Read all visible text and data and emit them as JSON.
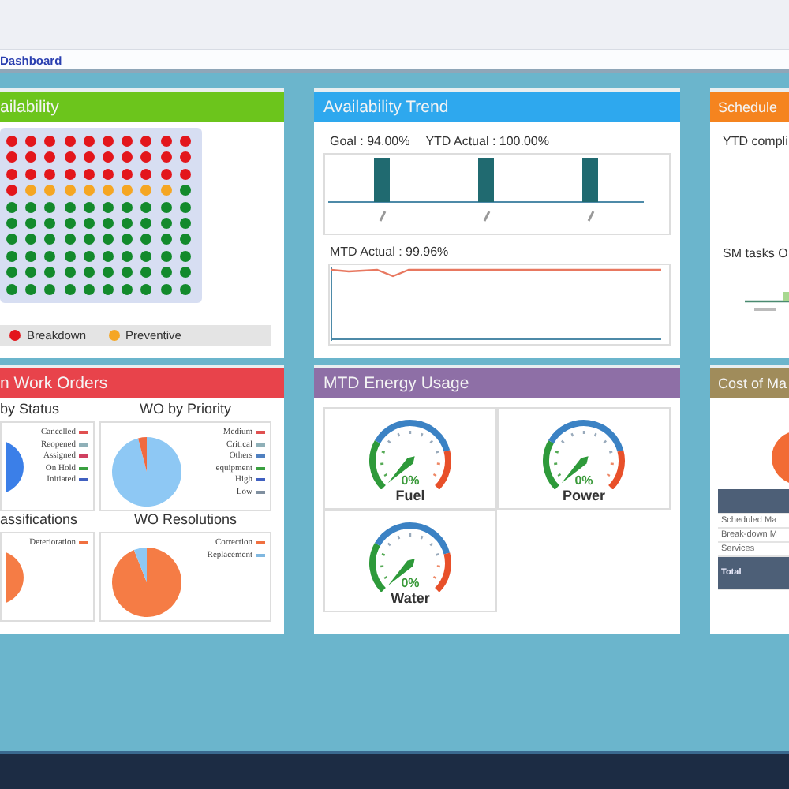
{
  "top_bar": {
    "breadcrumb": "Dashboard"
  },
  "availability": {
    "title": "ailability",
    "color": "#6cc51c",
    "dot_rows": [
      {
        "dots": [
          {
            "color": "#e3161c"
          },
          {
            "color": "#e3161c"
          },
          {
            "color": "#e3161c"
          },
          {
            "color": "#e3161c"
          },
          {
            "color": "#e3161c"
          },
          {
            "color": "#e3161c"
          },
          {
            "color": "#e3161c"
          },
          {
            "color": "#e3161c"
          },
          {
            "color": "#e3161c"
          },
          {
            "color": "#e3161c"
          }
        ]
      },
      {
        "dots": [
          {
            "color": "#e3161c"
          },
          {
            "color": "#e3161c"
          },
          {
            "color": "#e3161c"
          },
          {
            "color": "#e3161c"
          },
          {
            "color": "#e3161c"
          },
          {
            "color": "#e3161c"
          },
          {
            "color": "#e3161c"
          },
          {
            "color": "#e3161c"
          },
          {
            "color": "#e3161c"
          },
          {
            "color": "#e3161c"
          }
        ]
      },
      {
        "dots": [
          {
            "color": "#e3161c"
          },
          {
            "color": "#e3161c"
          },
          {
            "color": "#e3161c"
          },
          {
            "color": "#e3161c"
          },
          {
            "color": "#e3161c"
          },
          {
            "color": "#e3161c"
          },
          {
            "color": "#e3161c"
          },
          {
            "color": "#e3161c"
          },
          {
            "color": "#e3161c"
          },
          {
            "color": "#e3161c"
          }
        ]
      },
      {
        "dots": [
          {
            "color": "#e3161c"
          },
          {
            "color": "#f5a623"
          },
          {
            "color": "#f5a623"
          },
          {
            "color": "#f5a623"
          },
          {
            "color": "#f5a623"
          },
          {
            "color": "#f5a623"
          },
          {
            "color": "#f5a623"
          },
          {
            "color": "#f5a623"
          },
          {
            "color": "#f5a623"
          },
          {
            "color": "#138a2c"
          }
        ]
      },
      {
        "dots": [
          {
            "color": "#138a2c"
          },
          {
            "color": "#138a2c"
          },
          {
            "color": "#138a2c"
          },
          {
            "color": "#138a2c"
          },
          {
            "color": "#138a2c"
          },
          {
            "color": "#138a2c"
          },
          {
            "color": "#138a2c"
          },
          {
            "color": "#138a2c"
          },
          {
            "color": "#138a2c"
          },
          {
            "color": "#138a2c"
          }
        ]
      },
      {
        "dots": [
          {
            "color": "#138a2c"
          },
          {
            "color": "#138a2c"
          },
          {
            "color": "#138a2c"
          },
          {
            "color": "#138a2c"
          },
          {
            "color": "#138a2c"
          },
          {
            "color": "#138a2c"
          },
          {
            "color": "#138a2c"
          },
          {
            "color": "#138a2c"
          },
          {
            "color": "#138a2c"
          },
          {
            "color": "#138a2c"
          }
        ]
      },
      {
        "dots": [
          {
            "color": "#138a2c"
          },
          {
            "color": "#138a2c"
          },
          {
            "color": "#138a2c"
          },
          {
            "color": "#138a2c"
          },
          {
            "color": "#138a2c"
          },
          {
            "color": "#138a2c"
          },
          {
            "color": "#138a2c"
          },
          {
            "color": "#138a2c"
          },
          {
            "color": "#138a2c"
          },
          {
            "color": "#138a2c"
          }
        ]
      },
      {
        "dots": [
          {
            "color": "#138a2c"
          },
          {
            "color": "#138a2c"
          },
          {
            "color": "#138a2c"
          },
          {
            "color": "#138a2c"
          },
          {
            "color": "#138a2c"
          },
          {
            "color": "#138a2c"
          },
          {
            "color": "#138a2c"
          },
          {
            "color": "#138a2c"
          },
          {
            "color": "#138a2c"
          },
          {
            "color": "#138a2c"
          }
        ]
      },
      {
        "dots": [
          {
            "color": "#138a2c"
          },
          {
            "color": "#138a2c"
          },
          {
            "color": "#138a2c"
          },
          {
            "color": "#138a2c"
          },
          {
            "color": "#138a2c"
          },
          {
            "color": "#138a2c"
          },
          {
            "color": "#138a2c"
          },
          {
            "color": "#138a2c"
          },
          {
            "color": "#138a2c"
          },
          {
            "color": "#138a2c"
          }
        ]
      },
      {
        "dots": [
          {
            "color": "#138a2c"
          },
          {
            "color": "#138a2c"
          },
          {
            "color": "#138a2c"
          },
          {
            "color": "#138a2c"
          },
          {
            "color": "#138a2c"
          },
          {
            "color": "#138a2c"
          },
          {
            "color": "#138a2c"
          },
          {
            "color": "#138a2c"
          },
          {
            "color": "#138a2c"
          },
          {
            "color": "#138a2c"
          }
        ]
      }
    ],
    "legend": [
      {
        "label": "Breakdown",
        "color": "#e3161c"
      },
      {
        "label": "Preventive",
        "color": "#f5a623"
      }
    ]
  },
  "availability_trend": {
    "title": "Availability Trend",
    "color": "#2ea8ee",
    "goal": "Goal : 94.00%",
    "ytd_actual": "YTD Actual : 100.00%",
    "mtd_actual": "MTD Actual : 99.96%"
  },
  "scheduled": {
    "title": "Schedule",
    "color": "#f5841f",
    "ytd_compliance": "YTD compli",
    "sm_tasks": "SM tasks O"
  },
  "work_orders": {
    "title": "n Work Orders",
    "color": "#e8434b",
    "charts": [
      {
        "title": "by Status",
        "legend": [
          {
            "label": "Cancelled",
            "color": "#e05050"
          },
          {
            "label": "Reopened",
            "color": "#8fb0b8"
          },
          {
            "label": "Assigned",
            "color": "#d04060"
          },
          {
            "label": "On Hold",
            "color": "#3aa040"
          },
          {
            "label": "Initiated",
            "color": "#4060c0"
          }
        ]
      },
      {
        "title": "WO by Priority",
        "legend": [
          {
            "label": "Medium",
            "color": "#e05050"
          },
          {
            "label": "Critical",
            "color": "#8fb0b8"
          },
          {
            "label": "Others",
            "color": "#5080c0"
          },
          {
            "label": "equipment",
            "color": "#3aa040"
          },
          {
            "label": "High",
            "color": "#4060c0"
          },
          {
            "label": "Low",
            "color": "#8090a0"
          }
        ]
      },
      {
        "title": "assifications",
        "legend": [
          {
            "label": "Deterioration",
            "color": "#f07040"
          }
        ]
      },
      {
        "title": "WO Resolutions",
        "legend": [
          {
            "label": "Correction",
            "color": "#f07040"
          },
          {
            "label": "Replacement",
            "color": "#80b8e0"
          }
        ]
      }
    ]
  },
  "energy": {
    "title": "MTD Energy Usage",
    "color": "#8e6fa6",
    "gauges": [
      {
        "label": "Fuel",
        "reading": "0%"
      },
      {
        "label": "Power",
        "reading": "0%"
      },
      {
        "label": "Water",
        "reading": "0%"
      }
    ]
  },
  "cost": {
    "title": "Cost of Ma",
    "color": "#a08c5b",
    "rows": [
      {
        "label": "Scheduled Ma",
        "kind": "item"
      },
      {
        "label": "Break-down M",
        "kind": "item"
      },
      {
        "label": "Services",
        "kind": "item"
      },
      {
        "label": "Total",
        "kind": "total"
      }
    ]
  }
}
